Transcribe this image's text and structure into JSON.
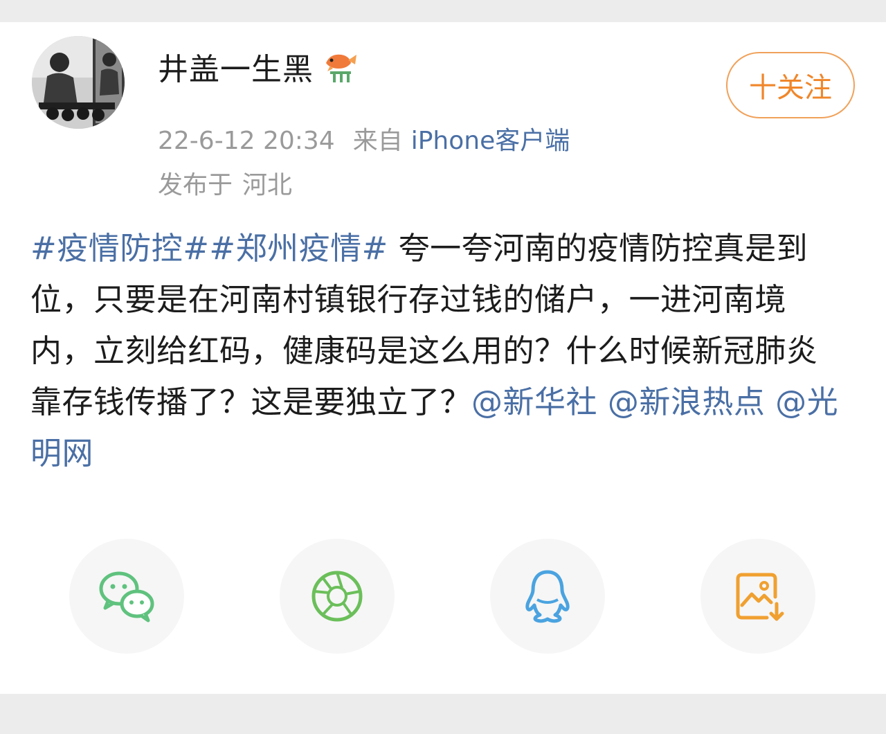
{
  "user": {
    "name": "井盖一生黑",
    "badge_icon": "koi-fish-badge-icon"
  },
  "meta": {
    "time": "22-6-12 20:34",
    "from_label": "来自",
    "source": "iPhone客户端",
    "location_label": "发布于",
    "location": "河北"
  },
  "follow_button": {
    "label": "十关注",
    "color": "#f0862a"
  },
  "post": {
    "topic1": "#疫情防控#",
    "topic2": "#郑州疫情#",
    "text": " 夸一夸河南的疫情防控真是到位，只要是在河南村镇银行存过钱的储户，一进河南境内，立刻给红码，健康码是这么用的？什么时候新冠肺炎靠存钱传播了？这是要独立了？",
    "mention1": "@新华社",
    "mention2": "@新浪热点",
    "mention3": "@光明网",
    "link_color": "#4a6fa5"
  },
  "share": [
    {
      "name": "wechat-icon",
      "color": "#5fc27e"
    },
    {
      "name": "moments-icon",
      "color": "#6bbf5a"
    },
    {
      "name": "qq-icon",
      "color": "#4aa3e0"
    },
    {
      "name": "save-image-icon",
      "color": "#f0a030"
    }
  ]
}
